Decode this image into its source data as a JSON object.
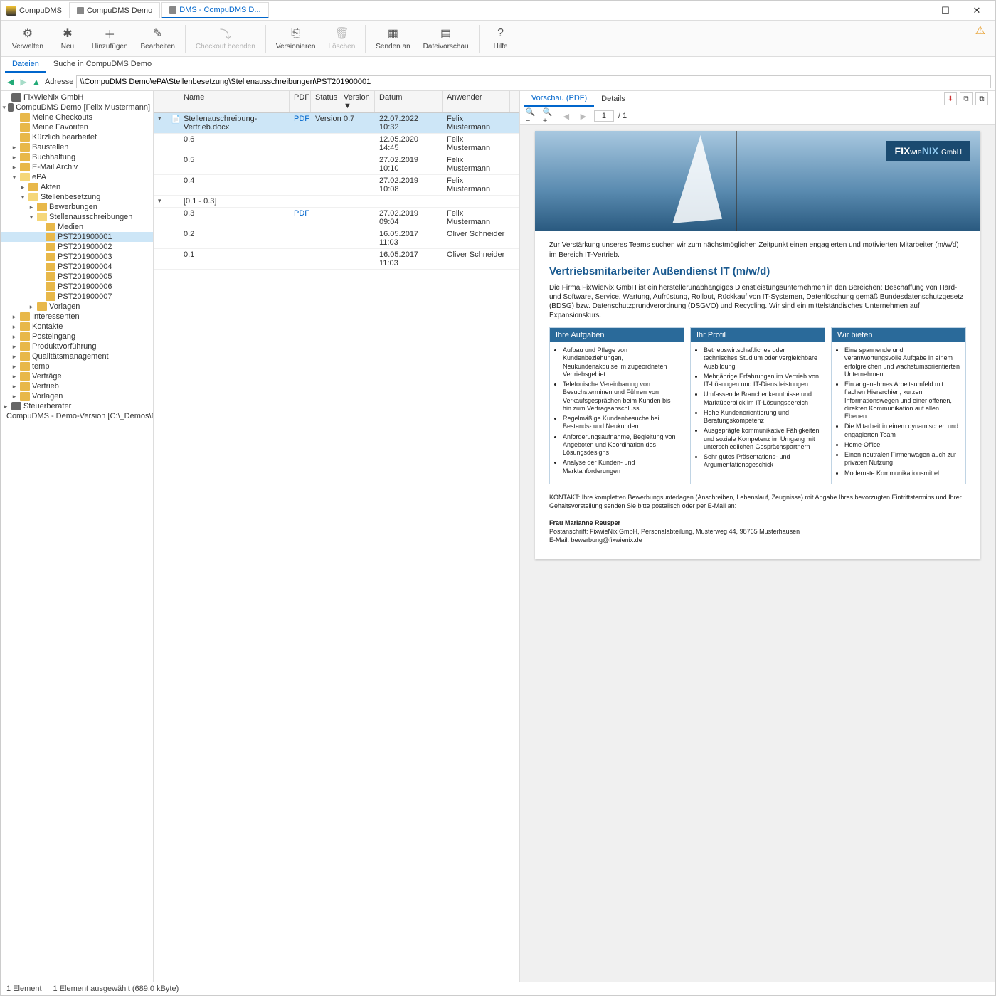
{
  "app_title": "CompuDMS",
  "tabs": [
    {
      "label": "CompuDMS Demo",
      "active": false
    },
    {
      "label": "DMS - CompuDMS D...",
      "active": true
    }
  ],
  "ribbon": [
    {
      "id": "verwalten",
      "label": "Verwalten",
      "icon": "⚙"
    },
    {
      "id": "neu",
      "label": "Neu",
      "icon": "✱"
    },
    {
      "id": "hinzufuegen",
      "label": "Hinzufügen",
      "icon": "＋"
    },
    {
      "id": "bearbeiten",
      "label": "Bearbeiten",
      "icon": "✎"
    },
    {
      "id": "checkout",
      "label": "Checkout beenden",
      "icon": "⤵",
      "disabled": true
    },
    {
      "id": "versionieren",
      "label": "Versionieren",
      "icon": "⎘"
    },
    {
      "id": "loeschen",
      "label": "Löschen",
      "icon": "🗑",
      "disabled": true
    },
    {
      "id": "sendenan",
      "label": "Senden an",
      "icon": "▦"
    },
    {
      "id": "dateivorschau",
      "label": "Dateivorschau",
      "icon": "▤"
    },
    {
      "id": "hilfe",
      "label": "Hilfe",
      "icon": "?"
    }
  ],
  "subtabs": [
    {
      "label": "Dateien",
      "active": true
    },
    {
      "label": "Suche in CompuDMS Demo",
      "active": false
    }
  ],
  "address_label": "Adresse",
  "address_value": "\\\\CompuDMS Demo\\ePA\\Stellenbesetzung\\Stellenausschreibungen\\PST201900001",
  "tree": [
    {
      "ind": 0,
      "exp": "",
      "icon": "repo",
      "label": "FixWieNix GmbH"
    },
    {
      "ind": 0,
      "exp": "▾",
      "icon": "repo",
      "label": "CompuDMS Demo  [Felix Mustermann]"
    },
    {
      "ind": 1,
      "exp": "",
      "icon": "fc",
      "label": "Meine Checkouts"
    },
    {
      "ind": 1,
      "exp": "",
      "icon": "fc",
      "label": "Meine Favoriten"
    },
    {
      "ind": 1,
      "exp": "",
      "icon": "fc",
      "label": "Kürzlich bearbeitet"
    },
    {
      "ind": 1,
      "exp": "▸",
      "icon": "fc",
      "label": "Baustellen"
    },
    {
      "ind": 1,
      "exp": "▸",
      "icon": "fc",
      "label": "Buchhaltung"
    },
    {
      "ind": 1,
      "exp": "▸",
      "icon": "fc",
      "label": "E-Mail Archiv"
    },
    {
      "ind": 1,
      "exp": "▾",
      "icon": "fo",
      "label": "ePA"
    },
    {
      "ind": 2,
      "exp": "▸",
      "icon": "fc",
      "label": "Akten"
    },
    {
      "ind": 2,
      "exp": "▾",
      "icon": "fo",
      "label": "Stellenbesetzung"
    },
    {
      "ind": 3,
      "exp": "▸",
      "icon": "fc",
      "label": "Bewerbungen"
    },
    {
      "ind": 3,
      "exp": "▾",
      "icon": "fo",
      "label": "Stellenausschreibungen"
    },
    {
      "ind": 4,
      "exp": "",
      "icon": "fc",
      "label": "Medien"
    },
    {
      "ind": 4,
      "exp": "",
      "icon": "fc",
      "label": "PST201900001",
      "selected": true
    },
    {
      "ind": 4,
      "exp": "",
      "icon": "fc",
      "label": "PST201900002"
    },
    {
      "ind": 4,
      "exp": "",
      "icon": "fc",
      "label": "PST201900003"
    },
    {
      "ind": 4,
      "exp": "",
      "icon": "fc",
      "label": "PST201900004"
    },
    {
      "ind": 4,
      "exp": "",
      "icon": "fc",
      "label": "PST201900005"
    },
    {
      "ind": 4,
      "exp": "",
      "icon": "fc",
      "label": "PST201900006"
    },
    {
      "ind": 4,
      "exp": "",
      "icon": "fc",
      "label": "PST201900007"
    },
    {
      "ind": 3,
      "exp": "▸",
      "icon": "fc",
      "label": "Vorlagen"
    },
    {
      "ind": 1,
      "exp": "▸",
      "icon": "fc",
      "label": "Interessenten"
    },
    {
      "ind": 1,
      "exp": "▸",
      "icon": "fc",
      "label": "Kontakte"
    },
    {
      "ind": 1,
      "exp": "▸",
      "icon": "fc",
      "label": "Posteingang"
    },
    {
      "ind": 1,
      "exp": "▸",
      "icon": "fc",
      "label": "Produktvorführung"
    },
    {
      "ind": 1,
      "exp": "▸",
      "icon": "fc",
      "label": "Qualitätsmanagement"
    },
    {
      "ind": 1,
      "exp": "▸",
      "icon": "fc",
      "label": "temp"
    },
    {
      "ind": 1,
      "exp": "▸",
      "icon": "fc",
      "label": "Verträge"
    },
    {
      "ind": 1,
      "exp": "▸",
      "icon": "fc",
      "label": "Vertrieb"
    },
    {
      "ind": 1,
      "exp": "▸",
      "icon": "fc",
      "label": "Vorlagen"
    },
    {
      "ind": 0,
      "exp": "▸",
      "icon": "repo",
      "label": "Steuerberater"
    },
    {
      "ind": 0,
      "exp": "",
      "icon": "repo",
      "label": "CompuDMS - Demo-Version  [C:\\_Demos\\Demo-Repositories..."
    }
  ],
  "grid_headers": {
    "name": "Name",
    "pdf": "PDF",
    "status": "Status",
    "version": "Version ▼",
    "date": "Datum",
    "user": "Anwender"
  },
  "grid_rows": [
    {
      "exp": "▾",
      "icon": "doc",
      "name": "Stellenauschreibung-Vertrieb.docx",
      "pdf": "PDF",
      "status": "Version",
      "ver": "0.7",
      "date": "22.07.2022 10:32",
      "user": "Felix Mustermann",
      "main": true
    },
    {
      "exp": "",
      "name": "0.6",
      "pdf": "",
      "status": "",
      "ver": "",
      "date": "12.05.2020 14:45",
      "user": "Felix Mustermann"
    },
    {
      "exp": "",
      "name": "0.5",
      "pdf": "",
      "status": "",
      "ver": "",
      "date": "27.02.2019 10:10",
      "user": "Felix Mustermann"
    },
    {
      "exp": "",
      "name": "0.4",
      "pdf": "",
      "status": "",
      "ver": "",
      "date": "27.02.2019 10:08",
      "user": "Felix Mustermann"
    },
    {
      "exp": "▾",
      "name": "[0.1 - 0.3]",
      "pdf": "",
      "status": "",
      "ver": "",
      "date": "",
      "user": ""
    },
    {
      "exp": "",
      "name": "0.3",
      "pdf": "PDF",
      "status": "",
      "ver": "",
      "date": "27.02.2019 09:04",
      "user": "Felix Mustermann"
    },
    {
      "exp": "",
      "name": "0.2",
      "pdf": "",
      "status": "",
      "ver": "",
      "date": "16.05.2017 11:03",
      "user": "Oliver Schneider"
    },
    {
      "exp": "",
      "name": "0.1",
      "pdf": "",
      "status": "",
      "ver": "",
      "date": "16.05.2017 11:03",
      "user": "Oliver Schneider"
    }
  ],
  "preview_tabs": [
    {
      "label": "Vorschau (PDF)",
      "active": true
    },
    {
      "label": "Details",
      "active": false
    }
  ],
  "pdf_page": "1",
  "pdf_pages_total": "/ 1",
  "doc": {
    "company": "FIXwieNIX",
    "company_suffix": "GmbH",
    "intro": "Zur Verstärkung unseres Teams suchen wir zum nächstmöglichen Zeitpunkt einen engagierten und motivierten Mitarbeiter (m/w/d) im Bereich IT-Vertrieb.",
    "title": "Vertriebsmitarbeiter Außendienst IT (m/w/d)",
    "desc": "Die Firma FixWieNix GmbH ist ein herstellerunabhängiges Dienstleistungsunternehmen in den Bereichen: Beschaffung von Hard- und Software, Service, Wartung, Aufrüstung, Rollout, Rückkauf von IT-Systemen, Datenlöschung gemäß Bundesdatenschutzgesetz (BDSG) bzw. Datenschutzgrundverordnung (DSGVO) und Recycling. Wir sind ein mittelständisches Unternehmen auf Expansionskurs.",
    "col1_title": "Ihre Aufgaben",
    "col1_items": [
      "Aufbau und Pflege von Kundenbeziehungen, Neukundenakquise im zugeordneten Vertriebsgebiet",
      "Telefonische Vereinbarung von Besuchsterminen und Führen von Verkaufsgesprächen beim Kunden bis hin zum Vertragsabschluss",
      "Regelmäßige Kundenbesuche bei Bestands- und Neukunden",
      "Anforderungsaufnahme, Begleitung von Angeboten und Koordination des Lösungsdesigns",
      "Analyse der Kunden- und Marktanforderungen"
    ],
    "col2_title": "Ihr Profil",
    "col2_items": [
      "Betriebswirtschaftliches oder technisches Studium oder vergleichbare Ausbildung",
      "Mehrjährige Erfahrungen im Vertrieb von IT-Lösungen und IT-Dienstleistungen",
      "Umfassende Branchenkenntnisse und Marktüberblick im IT-Lösungsbereich",
      "Hohe Kundenorientierung und Beratungskompetenz",
      "Ausgeprägte kommunikative Fähigkeiten und soziale Kompetenz im Umgang mit unterschiedlichen Gesprächspartnern",
      "Sehr gutes Präsentations- und Argumentationsgeschick"
    ],
    "col3_title": "Wir bieten",
    "col3_items": [
      "Eine spannende und verantwortungsvolle Aufgabe in einem erfolgreichen und wachstumsorientierten Unternehmen",
      "Ein angenehmes Arbeitsumfeld mit flachen Hierarchien, kurzen Informationswegen und einer offenen, direkten Kommunikation auf allen Ebenen",
      "Die Mitarbeit in einem dynamischen und engagierten Team",
      "Home-Office",
      "Einen neutralen Firmenwagen auch zur privaten Nutzung",
      "Modernste Kommunikationsmittel"
    ],
    "contact_intro": "KONTAKT: Ihre kompletten Bewerbungsunterlagen (Anschreiben, Lebenslauf, Zeugnisse) mit Angabe Ihres bevorzugten Eintrittstermins und Ihrer Gehaltsvorstellung senden Sie bitte postalisch oder per E-Mail an:",
    "contact_name": "Frau Marianne Reusper",
    "contact_addr": "Postanschrift: FixwieNix GmbH, Personalabteilung, Musterweg 44, 98765 Musterhausen",
    "contact_mail": "E-Mail: bewerbung@fixwienix.de"
  },
  "status_left": "1 Element",
  "status_right": "1 Element ausgewählt (689,0 kByte)"
}
